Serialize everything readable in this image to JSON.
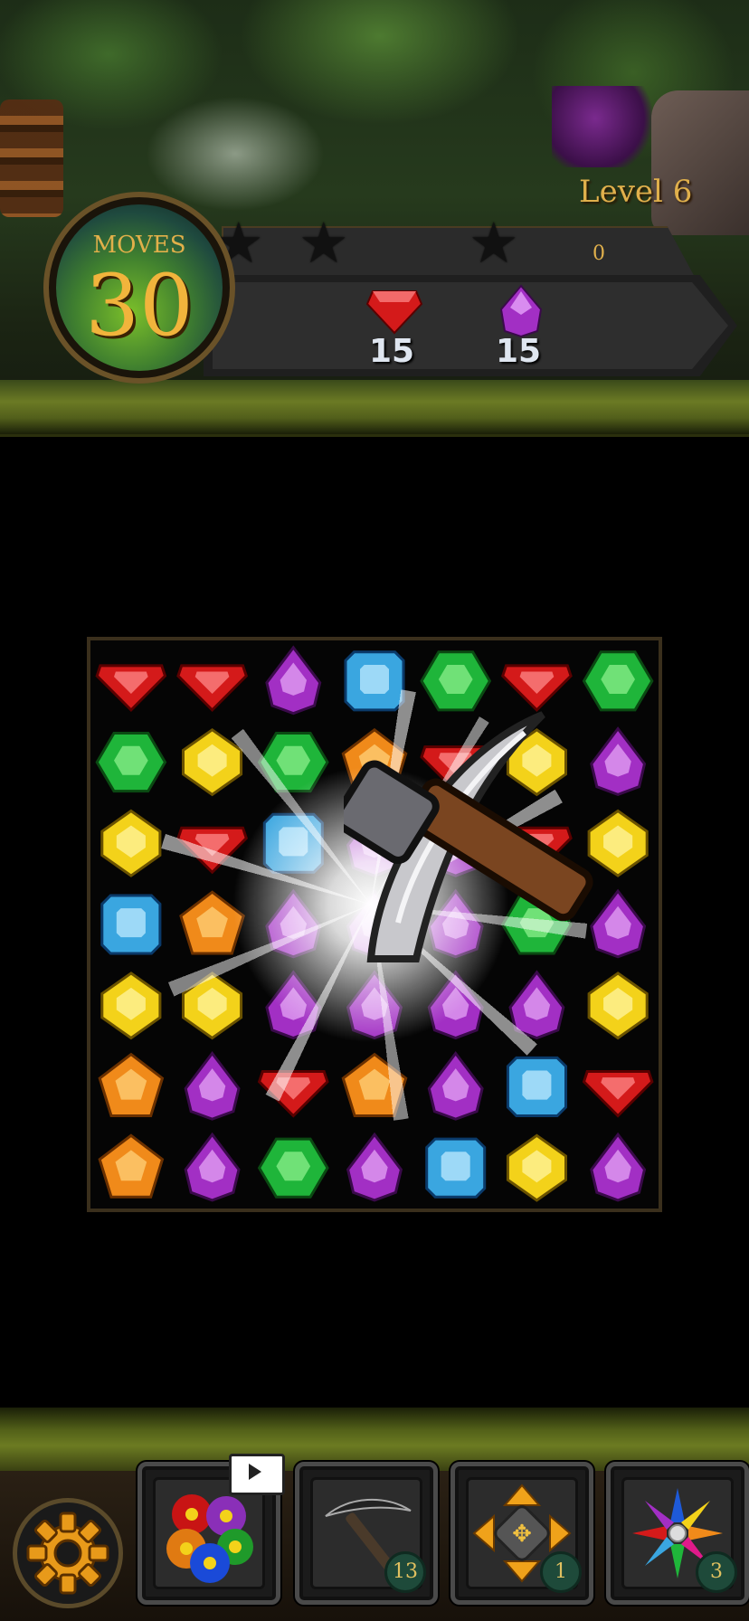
{
  "hud": {
    "level_label": "Level 6",
    "moves_label": "MOVES",
    "moves_value": "30",
    "score": "0",
    "stars_earned": 0,
    "stars_total": 3
  },
  "goals": [
    {
      "gem": "red-gem",
      "count": "15"
    },
    {
      "gem": "purple-gem",
      "count": "15"
    }
  ],
  "board": {
    "rows": 7,
    "cols": 7,
    "grid": [
      [
        "red",
        "red",
        "purple",
        "blue",
        "green",
        "red",
        "green"
      ],
      [
        "green",
        "yellow",
        "green",
        "orange",
        "red",
        "yellow",
        "purple"
      ],
      [
        "yellow",
        "red",
        "blue",
        "purple",
        "purple",
        "red",
        "yellow"
      ],
      [
        "blue",
        "orange",
        "purple",
        "purple",
        "purple",
        "green",
        "purple"
      ],
      [
        "yellow",
        "yellow",
        "purple",
        "purple",
        "purple",
        "purple",
        "yellow"
      ],
      [
        "orange",
        "purple",
        "red",
        "orange",
        "purple",
        "blue",
        "red"
      ],
      [
        "orange",
        "purple",
        "green",
        "purple",
        "blue",
        "yellow",
        "purple"
      ]
    ],
    "active_effect": "pickaxe-smash"
  },
  "colors": {
    "red": "#d41a1a",
    "green": "#1fb53a",
    "blue": "#3aa6e0",
    "yellow": "#f3d21a",
    "orange": "#f08a1a",
    "purple": "#a22fc4",
    "accent": "#e0b04c"
  },
  "boosters": [
    {
      "name": "bombs",
      "icon": "bombs-icon",
      "count": "",
      "video": true
    },
    {
      "name": "pickaxe",
      "icon": "pickaxe-icon",
      "count": "13"
    },
    {
      "name": "move-arrows",
      "icon": "arrows-icon",
      "count": "1"
    },
    {
      "name": "star-gem",
      "icon": "star-gem-icon",
      "count": "3"
    }
  ]
}
